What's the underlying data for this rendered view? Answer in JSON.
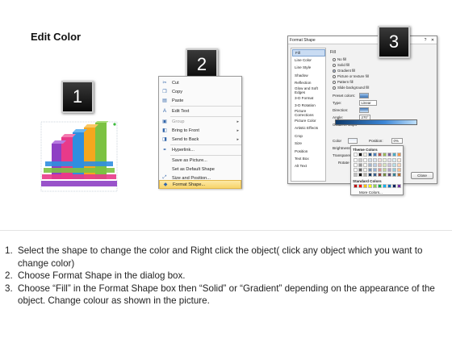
{
  "title": "Edit Color",
  "badges": [
    "1",
    "2",
    "3"
  ],
  "context_menu": {
    "items": [
      {
        "label": "Cut",
        "icon": "scissors-icon",
        "glyph": "✂",
        "disabled": false,
        "submenu": false,
        "highlight": false
      },
      {
        "label": "Copy",
        "icon": "copy-icon",
        "glyph": "❐",
        "disabled": false,
        "submenu": false,
        "highlight": false
      },
      {
        "label": "Paste",
        "icon": "paste-icon",
        "glyph": "▤",
        "disabled": false,
        "submenu": false,
        "highlight": false
      },
      {
        "label": "Edit Text",
        "icon": "edit-text-icon",
        "glyph": "A",
        "disabled": false,
        "submenu": false,
        "highlight": false
      },
      {
        "label": "Group",
        "icon": "group-icon",
        "glyph": "▣",
        "disabled": true,
        "submenu": true,
        "highlight": false
      },
      {
        "label": "Bring to Front",
        "icon": "bring-front-icon",
        "glyph": "◧",
        "disabled": false,
        "submenu": true,
        "highlight": false
      },
      {
        "label": "Send to Back",
        "icon": "send-back-icon",
        "glyph": "◨",
        "disabled": false,
        "submenu": true,
        "highlight": false
      },
      {
        "label": "Hyperlink...",
        "icon": "hyperlink-icon",
        "glyph": "⚭",
        "disabled": false,
        "submenu": false,
        "highlight": false
      },
      {
        "label": "Save as Picture...",
        "icon": "",
        "glyph": "",
        "disabled": false,
        "submenu": false,
        "highlight": false
      },
      {
        "label": "Set as Default Shape",
        "icon": "",
        "glyph": "",
        "disabled": false,
        "submenu": false,
        "highlight": false
      },
      {
        "label": "Size and Position...",
        "icon": "size-icon",
        "glyph": "⤢",
        "disabled": false,
        "submenu": false,
        "highlight": false
      },
      {
        "label": "Format Shape...",
        "icon": "format-shape-icon",
        "glyph": "◆",
        "disabled": false,
        "submenu": false,
        "highlight": true
      }
    ]
  },
  "format_dialog": {
    "title": "Format Shape",
    "nav": [
      "Fill",
      "Line Color",
      "Line Style",
      "Shadow",
      "Reflection",
      "Glow and Soft Edges",
      "3-D Format",
      "3-D Rotation",
      "Picture Corrections",
      "Picture Color",
      "Artistic Effects",
      "Crop",
      "Size",
      "Position",
      "Text Box",
      "Alt Text"
    ],
    "selected_nav": "Fill",
    "section_heading": "Fill",
    "fill_options": [
      "No fill",
      "Solid fill",
      "Gradient fill",
      "Picture or texture fill",
      "Pattern fill",
      "Slide background fill"
    ],
    "selected_fill": "Gradient fill",
    "fields": {
      "preset_label": "Preset colors:",
      "type_label": "Type:",
      "type_value": "Linear",
      "direction_label": "Direction:",
      "angle_label": "Angle:",
      "angle_value": "270°",
      "stops_label": "Gradient stops",
      "color_label": "Color",
      "position_label": "Position:",
      "position_value": "0%",
      "brightness_label": "Brightness",
      "transparency_label": "Transparency:",
      "rotate_label": "Rotate with shape"
    },
    "close_label": "Close"
  },
  "color_popup": {
    "theme_label": "Theme Colors",
    "standard_label": "Standard Colors",
    "more_label": "More Colors...",
    "theme_top": [
      "#ffffff",
      "#000000",
      "#eeece1",
      "#1f497d",
      "#4f81bd",
      "#c0504d",
      "#9bbb59",
      "#8064a2",
      "#4bacc6",
      "#f79646"
    ],
    "standard": [
      "#c00000",
      "#ff0000",
      "#ffc000",
      "#ffff00",
      "#92d050",
      "#00b050",
      "#00b0f0",
      "#0070c0",
      "#002060",
      "#7030a0"
    ]
  },
  "instructions": [
    {
      "num": "1.",
      "text": "Select the shape to change the color and Right click the object( click any object which you want to change color)"
    },
    {
      "num": "2.",
      "text": "Choose Format Shape in the dialog box."
    },
    {
      "num": "3.",
      "text": "Choose “Fill” in the Format Shape box then “Solid” or “Gradient” depending on the appearance of the object. Change colour as shown in the picture."
    }
  ]
}
